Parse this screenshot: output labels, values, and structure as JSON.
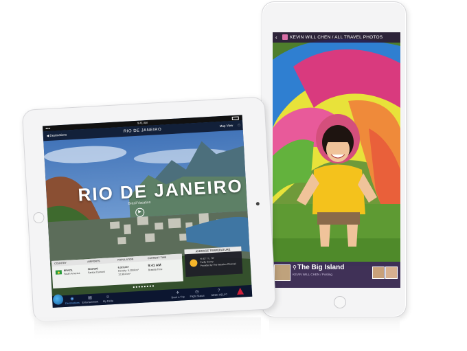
{
  "right_device": {
    "photos_header": "KEVIN WILL CHEN / ALL TRAVEL PHOTOS",
    "photo_title": "The Big Island",
    "photo_subtitle": "KEVIN WILL CHEN / Posting"
  },
  "left_device": {
    "status_time": "9:41 AM",
    "nav": {
      "back_label": "Destinations",
      "title": "RIO DE JANEIRO",
      "map_label": "Map View"
    },
    "city_name": "RIO DE JANEIRO",
    "city_subtitle": "Brazil Vacation",
    "info_headers": [
      "COUNTRY",
      "AIRPORTS",
      "POPULATION",
      "CURRENT TIME"
    ],
    "country": "BRAZIL",
    "country_sub": "South America",
    "airports": "SDU/GIG",
    "airports_sub": "Santos Dumont",
    "population": "6,323,037",
    "population_sub1": "Density: 5,200/km²",
    "population_sub2": "12,984 km²",
    "current_time": "9:41 AM",
    "current_time_sub": "Brasilia Time",
    "avg_temp_header": "AVERAGE TEMPERATURE",
    "temp_lines": [
      "H: 83° / L: 78°",
      "Partly Sunny",
      "Provided by The Weather Channel"
    ],
    "page_dots": "●●●●●●●●",
    "tabs": [
      {
        "glyph": "◉",
        "label": "Destinations"
      },
      {
        "glyph": "▤",
        "label": "Entertainment"
      },
      {
        "glyph": "☺",
        "label": "My Delta"
      },
      {
        "glyph": "✈",
        "label": "Book a Trip"
      },
      {
        "glyph": "◷",
        "label": "Flight Status"
      },
      {
        "glyph": "?",
        "label": "NEED HELP?"
      }
    ]
  },
  "colors": {
    "accent_blue": "#5fa6f0",
    "delta_red": "#d1203b",
    "tabbar": "#0c1630"
  }
}
